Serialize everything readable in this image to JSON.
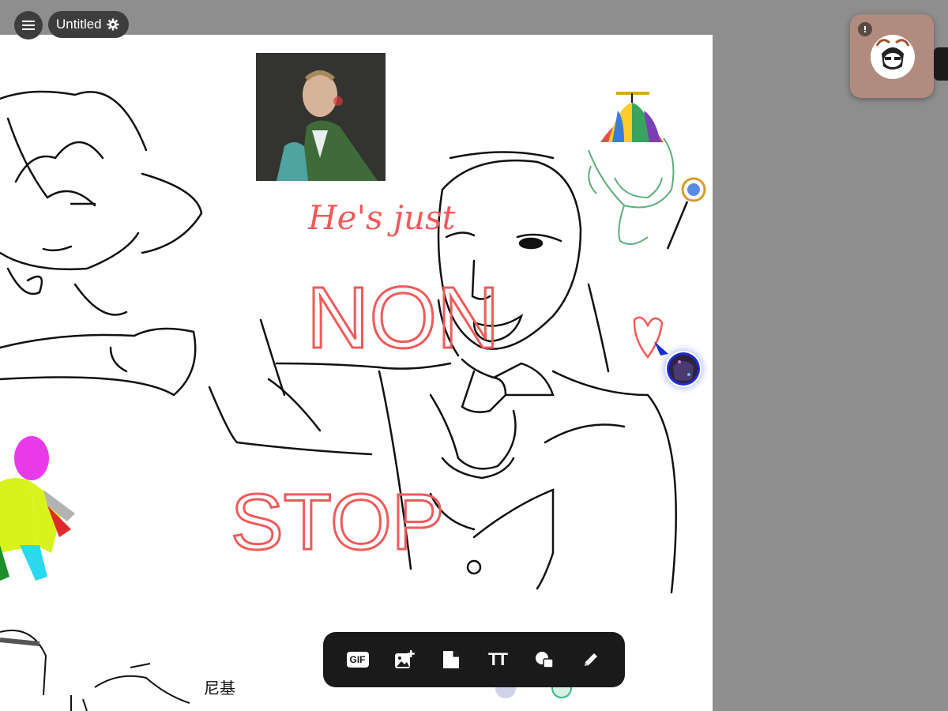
{
  "header": {
    "title": "Untitled",
    "menu_icon": "hamburger-menu-icon",
    "settings_icon": "gear-icon"
  },
  "canvas": {
    "texts": {
      "hes_just": "He's just",
      "non": "NON",
      "stop": "STOP",
      "cjk_label": "尼基"
    }
  },
  "toolbar": {
    "gif_label": "GIF",
    "text_tool_label": "TT",
    "items": [
      "gif-icon",
      "add-image-icon",
      "note-icon",
      "text-icon",
      "shapes-icon",
      "pencil-icon"
    ]
  },
  "colors": {
    "accent_red": "#f05a5a",
    "toolbar_bg": "#1a1a1a",
    "backdrop": "#8e8e8e",
    "cursor_blue": "#1e2bd6"
  }
}
